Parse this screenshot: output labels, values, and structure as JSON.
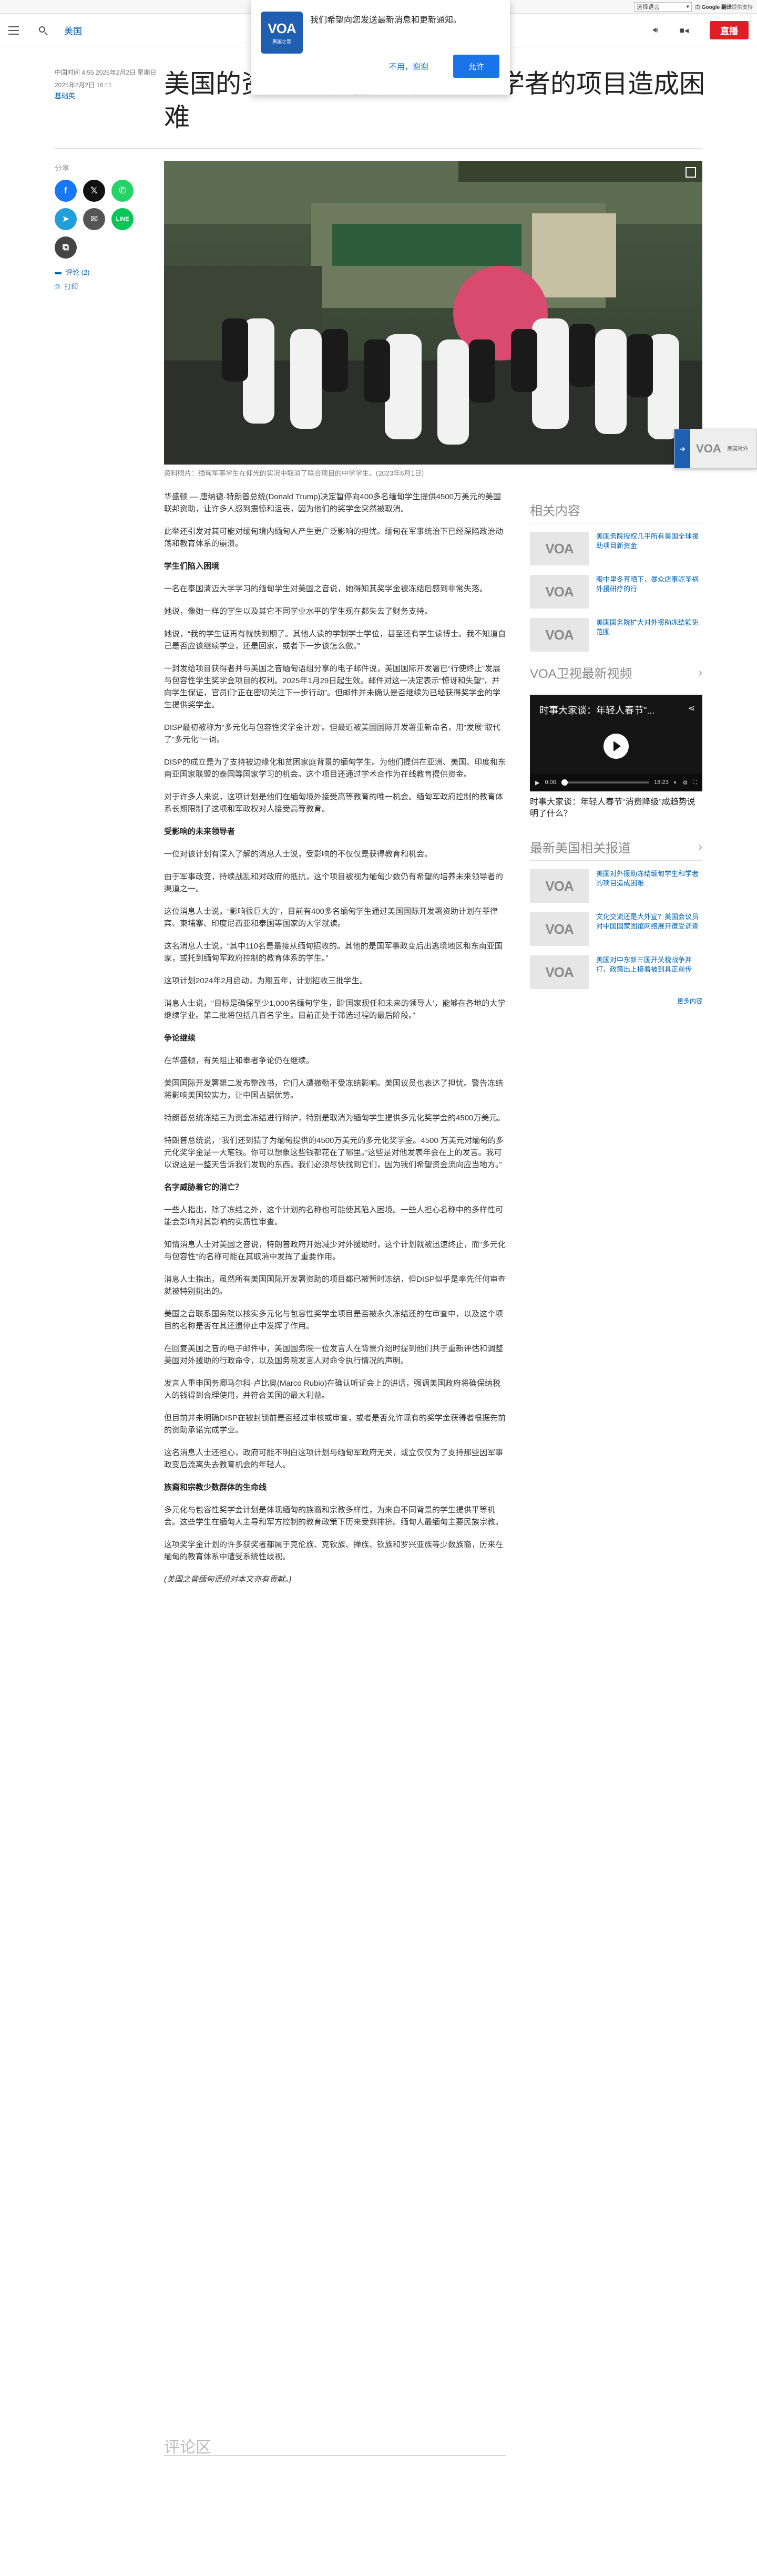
{
  "translate_bar": {
    "select_label": "选择语言",
    "powered_prefix": "由",
    "powered_brand": "Google",
    "powered_service": "翻译",
    "powered_suffix": "提供支持"
  },
  "header": {
    "section": "美国",
    "live_label": "直播"
  },
  "notification": {
    "logo_text": "VOA",
    "logo_sub": "美国之音",
    "message": "我们希望向您发送最新消息和更新通知。",
    "deny_label": "不用，谢谢",
    "allow_label": "允许"
  },
  "article": {
    "dates": "中国时间 4:55 2025年2月2日 星期日",
    "dates2": "2025年2月2日 16:11",
    "author": "基础英",
    "title": "美国的资金冻结给缅甸学生和学者的项目造成困难",
    "caption": "资料照片：缅甸军事学生在仰光的实况中取消了联合项目的中学学生。(2023年6月1日)",
    "paragraphs": [
      {
        "type": "p",
        "text": "华盛顿 — 唐纳德·特朗普总统(Donald Trump)决定暂停向400多名缅甸学生提供4500万美元的美国联邦资助，让许多人感到震惊和沮丧，因为他们的奖学金突然被取消。"
      },
      {
        "type": "p",
        "text": "此举还引发对其可能对缅甸境内缅甸人产生更广泛影响的担忧。缅甸在军事统治下已经深陷政治动荡和教育体系的崩溃。"
      },
      {
        "type": "h",
        "text": "学生们陷入困境"
      },
      {
        "type": "p",
        "text": "一名在泰国清迈大学学习的缅甸学生对美国之音说，她得知其奖学金被冻结后感到非常失落。"
      },
      {
        "type": "p",
        "text": "她说，像她一样的学生以及其它不同学业水平的学生现在都失去了财务支持。"
      },
      {
        "type": "p",
        "text": "她说，“我的学生证再有就快到期了。其他人读的学制学士学位，甚至还有学生读博士。我不知道自己是否应该继续学业，还是回家，或者下一步该怎么做。”"
      },
      {
        "type": "p",
        "text": "一封发给项目获得者并与美国之音缅甸语组分享的电子邮件说，美国国际开发署已“行使终止”发展与包容性学生奖学金项目的权利。2025年1月29日起生效。邮件对这一决定表示“惊讶和失望”，并向学生保证，官员们“正在密切关注下一步行动”。但邮件并未确认是否继续为已经获得奖学金的学生提供奖学金。"
      },
      {
        "type": "p",
        "text": "DISP最初被称为“多元化与包容性奖学金计划”。但最近被美国国际开发署重新命名，用“发展”取代了“多元化”一词。"
      },
      {
        "type": "p",
        "text": "DISP的成立是为了支持被边缘化和贫困家庭背景的缅甸学生。为他们提供在亚洲、美国、印度和东南亚国家联盟的泰国等国家学习的机会。这个项目还通过学术合作为在线教育提供资金。"
      },
      {
        "type": "p",
        "text": "对于许多人来说，这项计划是他们在缅甸境外接受高等教育的唯一机会。缅甸军政府控制的教育体系长期限制了这项和军政权对人接受高等教育。"
      },
      {
        "type": "h",
        "text": "受影响的未来领导者"
      },
      {
        "type": "p",
        "text": "一位对该计划有深入了解的消息人士说，受影响的不仅仅是获得教育和机会。"
      },
      {
        "type": "p",
        "text": "由于军事政变，持续战乱和对政府的抵抗，这个项目被视为缅甸少数仍有希望的培养未来领导者的渠道之一。"
      },
      {
        "type": "p",
        "text": "这位消息人士说，“影响很巨大的”，目前有400多名缅甸学生通过美国国际开发署资助计划在菲律宾、柬埔寨、印度尼西亚和泰国等国家的大学就读。"
      },
      {
        "type": "p",
        "text": "这名消息人士说，“其中110名是最接从缅甸招收的。其他的是国军事政变后出逃境地区和东南亚国家，或托到缅甸军政府控制的教育体系的学生。”"
      },
      {
        "type": "p",
        "text": "这项计划2024年2月启动，为期五年，计划招收三批学生。"
      },
      {
        "type": "p",
        "text": "消息人士说，“目标是确保至少1,000名缅甸学生，即‘国家现任和未来的领导人’，能够在各地的大学继续学业。第二批将包括几百名学生。目前正处于筛选过程的最后阶段。”"
      },
      {
        "type": "h",
        "text": "争论继续"
      },
      {
        "type": "p",
        "text": "在华盛顿，有关阻止和奉者争论仍在继续。"
      },
      {
        "type": "p",
        "text": "美国国际开发署第二发布整改书，它们人遭撤勤不受冻结影响。美国议员也表达了担忧。警告冻结将影响美国软实力，让中国占据优势。"
      },
      {
        "type": "p",
        "text": "特朗普总统冻结三为资金冻结进行辩护，特别是取消为缅甸学生提供多元化奖学金的4500万美元。"
      },
      {
        "type": "p",
        "text": "特朗普总统说，“我们还到猜了为缅甸提供的4500万美元的多元化奖学金。4500 万美元对缅甸的多元化奖学金是一大笔钱。你可以想象这些钱都花在了哪里。”这些是对他发表年会在上的发言。我可以说这是一整天告诉我们发现的东西。我们必须尽快找到它们，因为我们希望资金流向应当地方。”"
      },
      {
        "type": "h",
        "text": "名字威胁着它的消亡？"
      },
      {
        "type": "p",
        "text": "一些人指出，除了冻结之外，这个计划的名称也可能使其陷入困境。一些人担心名称中的多样性可能会影响对其影响的实质性审查。"
      },
      {
        "type": "p",
        "text": "知情消息人士对美国之音说，特朗普政府开始减少对外援助时，这个计划就被迅速终止，而“多元化与包容性”的名称可能在其取消中发挥了重要作用。"
      },
      {
        "type": "p",
        "text": "消息人士指出，虽然所有美国国际开发署资助的项目都已被暂时冻结，但DISP似乎是率先任何审查就被特别挑出的。"
      },
      {
        "type": "p",
        "text": "美国之音联系国务院以核实多元化与包容性奖学金项目是否被永久冻结还的在审查中，以及这个项目的名称是否在其还遗停止中发挥了作用。"
      },
      {
        "type": "p",
        "text": "在回复美国之音的电子邮件中，美国国务院一位发言人在背景介绍时提到他们共于重新评估和调整美国对外援助的行政命令，以及国务院发言人对命令执行情况的声明。"
      },
      {
        "type": "p",
        "text": "发言人重申国务卿马尔科·卢比奥(Marco Rubio)在确认听证会上的讲话，强调美国政府将确保纳税人的钱得到合理使用，并符合美国的最大利益。"
      },
      {
        "type": "p",
        "text": "但目前并未明确DISP在被封锁前是否经过审核或审查，或者是否允许现有的奖学金获得者根据先前的资助承诺完成学业。"
      },
      {
        "type": "p",
        "text": "这名消息人士还担心，政府可能不明白这项计划与缅甸军政府无关，或立仅仅为了支持那些因军事政变后流离失去教育机会的年轻人。"
      },
      {
        "type": "h",
        "text": "族裔和宗教少数群体的生命线"
      },
      {
        "type": "p",
        "text": "多元化与包容性奖学金计划是体现缅甸的族裔和宗教多样性，为来自不同背景的学生提供平等机会。这些学生在缅甸人主导和军方控制的教育政策下历来受到排挤。缅甸人最缅甸主要民族宗教。"
      },
      {
        "type": "p",
        "text": "这项奖学金计划的许多获奖者都属于克伦族、克钦族、掸族、钦族和罗兴亚族等少数族裔，历来在缅甸的教育体系中遭受系统性歧视。"
      },
      {
        "type": "i",
        "text": "(美国之音缅甸语组对本文亦有贡献。)"
      }
    ],
    "comments_label": "评论区"
  },
  "share": {
    "label": "分享",
    "comment_link": "评论 (2)",
    "print_link": "打印"
  },
  "right_column": {
    "related_title": "相关内容",
    "related": [
      {
        "text": "美国务院授权几乎所有美国全球援助项目新资金"
      },
      {
        "text": "眼中里冬育晒下，暴众店事呢圣祸外援研疗的行"
      },
      {
        "text": "美国国务院扩大对外援助冻结额免范围"
      }
    ],
    "video_title": "VOA卫视最新视频",
    "video": {
      "overlay_title": "时事大家谈：年轻人春节\"...",
      "time_current": "0:00",
      "time_total": "18:23",
      "caption": "时事大家谈：年轻人春节“消费降级”成趋势说明了什么？"
    },
    "latest_title": "最新美国相关报道",
    "latest": [
      {
        "text": "美国对外援助冻结缅甸学生和学者的项目造成困难"
      },
      {
        "text": "文化交流还是大外宣？美国会议员对中国国家图馆网络展开遭受调查"
      },
      {
        "text": "美国对中东新三国开关税战争并打，政策出上接着被到具正前传"
      }
    ],
    "more_label": "更多内容"
  },
  "mini_player": {
    "logo": "VOA",
    "text": "美国对外"
  },
  "colors": {
    "brand_blue": "#0162b1",
    "live_red": "#e21d25",
    "notif_blue": "#1a73e8"
  }
}
